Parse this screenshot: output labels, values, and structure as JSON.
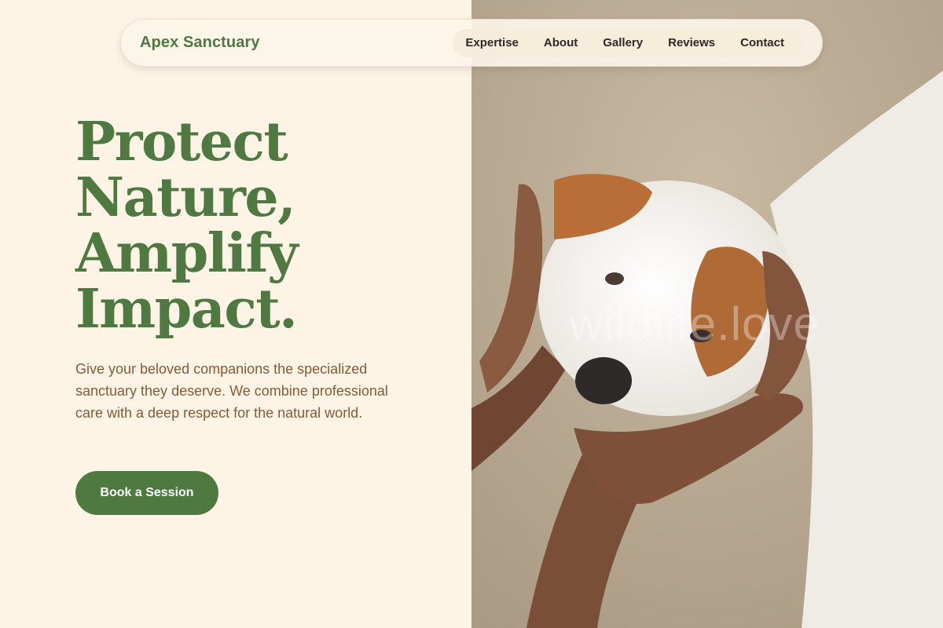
{
  "header": {
    "brand": "Apex Sanctuary",
    "nav": [
      "Expertise",
      "About",
      "Gallery",
      "Reviews",
      "Contact"
    ]
  },
  "hero": {
    "headline": [
      "Protect",
      "Nature,",
      "Amplify",
      "Impact."
    ],
    "subtext": "Give your beloved companions the specialized sanctuary they deserve. We combine professional care with a deep respect for the natural world.",
    "cta_label": "Book a Session"
  },
  "photo": {
    "watermark": "wildlife.love"
  },
  "colors": {
    "accent": "#4e7a42",
    "background": "#fdf4e6",
    "body_text": "#8a5a35"
  }
}
